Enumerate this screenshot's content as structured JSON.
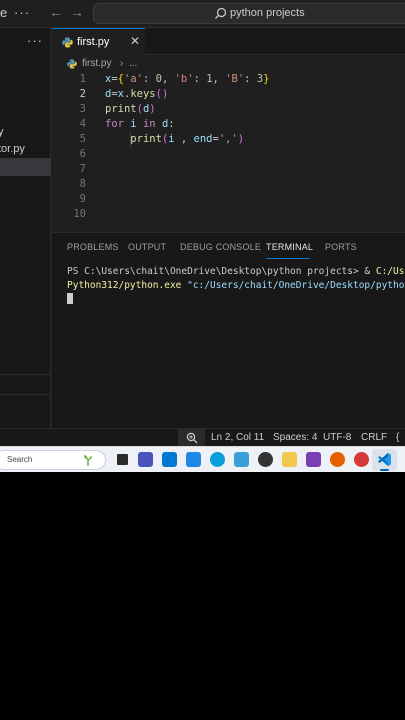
{
  "titlebar": {
    "menu_partial": "e",
    "dots": "···",
    "back_arrow": "←",
    "forward_arrow": "→",
    "search_text": "python projects"
  },
  "sidebar": {
    "more": "···",
    "file_partial_1": "y",
    "file_partial_2": "tor.py"
  },
  "tab": {
    "label": "first.py",
    "close": "✕"
  },
  "breadcrumb": {
    "file": "first.py",
    "separator": "›",
    "more": "..."
  },
  "editor": {
    "line_numbers": [
      "1",
      "2",
      "3",
      "4",
      "5",
      "6",
      "7",
      "8",
      "9",
      "10"
    ],
    "active_line": 2,
    "lines": [
      "x={'a': 0, 'b': 1, 'B': 3}",
      "d=x.keys()",
      "print(d)",
      "for i in d:",
      "    print(i , end=',')",
      "",
      "",
      "",
      "",
      ""
    ]
  },
  "panel": {
    "tabs": [
      "PROBLEMS",
      "OUTPUT",
      "DEBUG CONSOLE",
      "TERMINAL",
      "PORTS"
    ],
    "active_tab": "TERMINAL",
    "terminal_prompt": "PS C:\\Users\\chait\\OneDrive\\Desktop\\python projects> & ",
    "terminal_exe_1": "C:/Use",
    "terminal_exe_2": "Python312/python.exe",
    "terminal_arg": " \"c:/Users/chait/OneDrive/Desktop/python"
  },
  "statusbar": {
    "position": "Ln 2, Col 11",
    "indent": "Spaces: 4",
    "encoding": "UTF-8",
    "eol": "CRLF",
    "lang_partial": "{"
  },
  "taskbar": {
    "search_text": "Search"
  }
}
